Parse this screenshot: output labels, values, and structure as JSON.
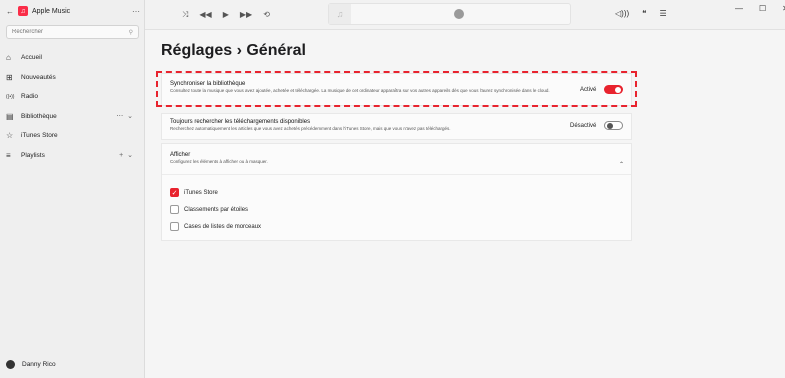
{
  "app": {
    "title": "Apple Music",
    "back_glyph": "←",
    "logo_glyph": "♫",
    "more_glyph": "⋯"
  },
  "search": {
    "placeholder": "Rechercher",
    "icon_glyph": "⚲"
  },
  "sidebar": {
    "items": [
      {
        "label": "Accueil",
        "icon": "⌂",
        "icon_name": "home-icon",
        "extra": ""
      },
      {
        "label": "Nouveautés",
        "icon": "⊞",
        "icon_name": "grid-icon",
        "extra": ""
      },
      {
        "label": "Radio",
        "icon": "((•))",
        "icon_name": "radio-icon",
        "extra": ""
      },
      {
        "label": "Bibliothèque",
        "icon": "▤",
        "icon_name": "library-icon",
        "extra": "⋯ ⌄"
      },
      {
        "label": "iTunes Store",
        "icon": "☆",
        "icon_name": "star-icon",
        "extra": ""
      },
      {
        "label": "Playlists",
        "icon": "≡",
        "icon_name": "playlists-icon",
        "extra": "+ ⌄"
      }
    ],
    "user_name": "Danny Rico"
  },
  "player": {
    "shuffle": "⤨",
    "prev": "◀◀",
    "play": "▶",
    "next": "▶▶",
    "repeat": "⟲",
    "note_glyph": "♫",
    "volume": "◁)))",
    "lyrics": "❝",
    "queue": "☰"
  },
  "window": {
    "minimize": "—",
    "maximize": "☐",
    "close": "✕"
  },
  "page": {
    "title": "Réglages › Général"
  },
  "settings": {
    "sync": {
      "title": "Synchroniser la bibliothèque",
      "desc": "Consultez toute la musique que vous avez ajoutée, achetée et téléchargée. La musique de cet ordinateur apparaîtra sur vos autres appareils dès que vous l'aurez synchronisée dans le cloud.",
      "state": "Activé",
      "on": true
    },
    "downloads": {
      "title": "Toujours rechercher les téléchargements disponibles",
      "desc": "Recherchez automatiquement les articles que vous avez achetés précédemment dans l'iTunes Store, mais que vous n'avez pas téléchargés.",
      "state": "Désactivé",
      "on": false
    },
    "show": {
      "title": "Afficher",
      "desc": "Configurez les éléments à afficher ou à masquer.",
      "chevron": "⌃",
      "options": [
        {
          "label": "iTunes Store",
          "checked": true
        },
        {
          "label": "Classements par étoiles",
          "checked": false
        },
        {
          "label": "Cases de listes de morceaux",
          "checked": false
        }
      ]
    }
  },
  "colors": {
    "accent": "#e8232e",
    "brand": "#fa2d48"
  }
}
